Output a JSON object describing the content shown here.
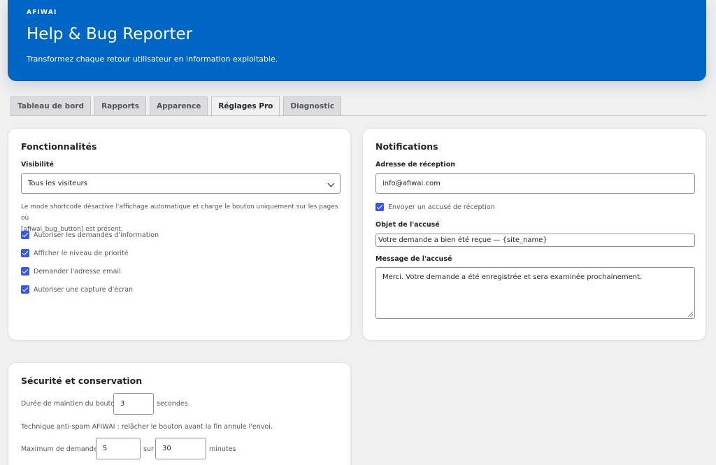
{
  "header": {
    "brand": "AFIWAI",
    "title": "Help & Bug Reporter",
    "subtitle": "Transformez chaque retour utilisateur en information exploitable."
  },
  "tabs": [
    {
      "label": "Tableau de bord",
      "active": false
    },
    {
      "label": "Rapports",
      "active": false
    },
    {
      "label": "Apparence",
      "active": false
    },
    {
      "label": "Réglages Pro",
      "active": true
    },
    {
      "label": "Diagnostic",
      "active": false
    }
  ],
  "features": {
    "title": "Fonctionnalités",
    "visibility_label": "Visibilité",
    "visibility_value": "Tous les visiteurs",
    "help_line1": "Le mode shortcode désactive l'affichage automatique et charge le bouton uniquement sur les pages où",
    "help_line2": "[afiwai_bug_button] est présent.",
    "checkboxes": [
      {
        "label": "Autoriser les demandes d'information",
        "checked": true
      },
      {
        "label": "Afficher le niveau de priorité",
        "checked": true
      },
      {
        "label": "Demander l'adresse email",
        "checked": true
      },
      {
        "label": "Autoriser une capture d'écran",
        "checked": true
      }
    ]
  },
  "notifications": {
    "title": "Notifications",
    "address_label": "Adresse de réception",
    "address_value": "info@afiwai.com",
    "ack_checkbox": "Envoyer un accusé de réception",
    "subject_label": "Objet de l'accusé",
    "subject_value": "Votre demande a bien été reçue — {site_name}",
    "message_label": "Message de l'accusé",
    "message_value": "Merci. Votre demande a été enregistrée et sera examinée prochainement."
  },
  "security": {
    "title": "Sécurité et conservation",
    "hold_label": "Durée de maintien du bouton",
    "hold_value": "3",
    "hold_unit": "secondes",
    "antispam_help": "Technique anti-spam AFIWAI : relâcher le bouton avant la fin annule l'envoi.",
    "max_label": "Maximum de demandes",
    "max_value": "5",
    "max_sep": "sur",
    "window_value": "30",
    "window_unit": "minutes"
  },
  "colors": {
    "hero": "#0066c6",
    "checkbox": "#3858e9"
  }
}
